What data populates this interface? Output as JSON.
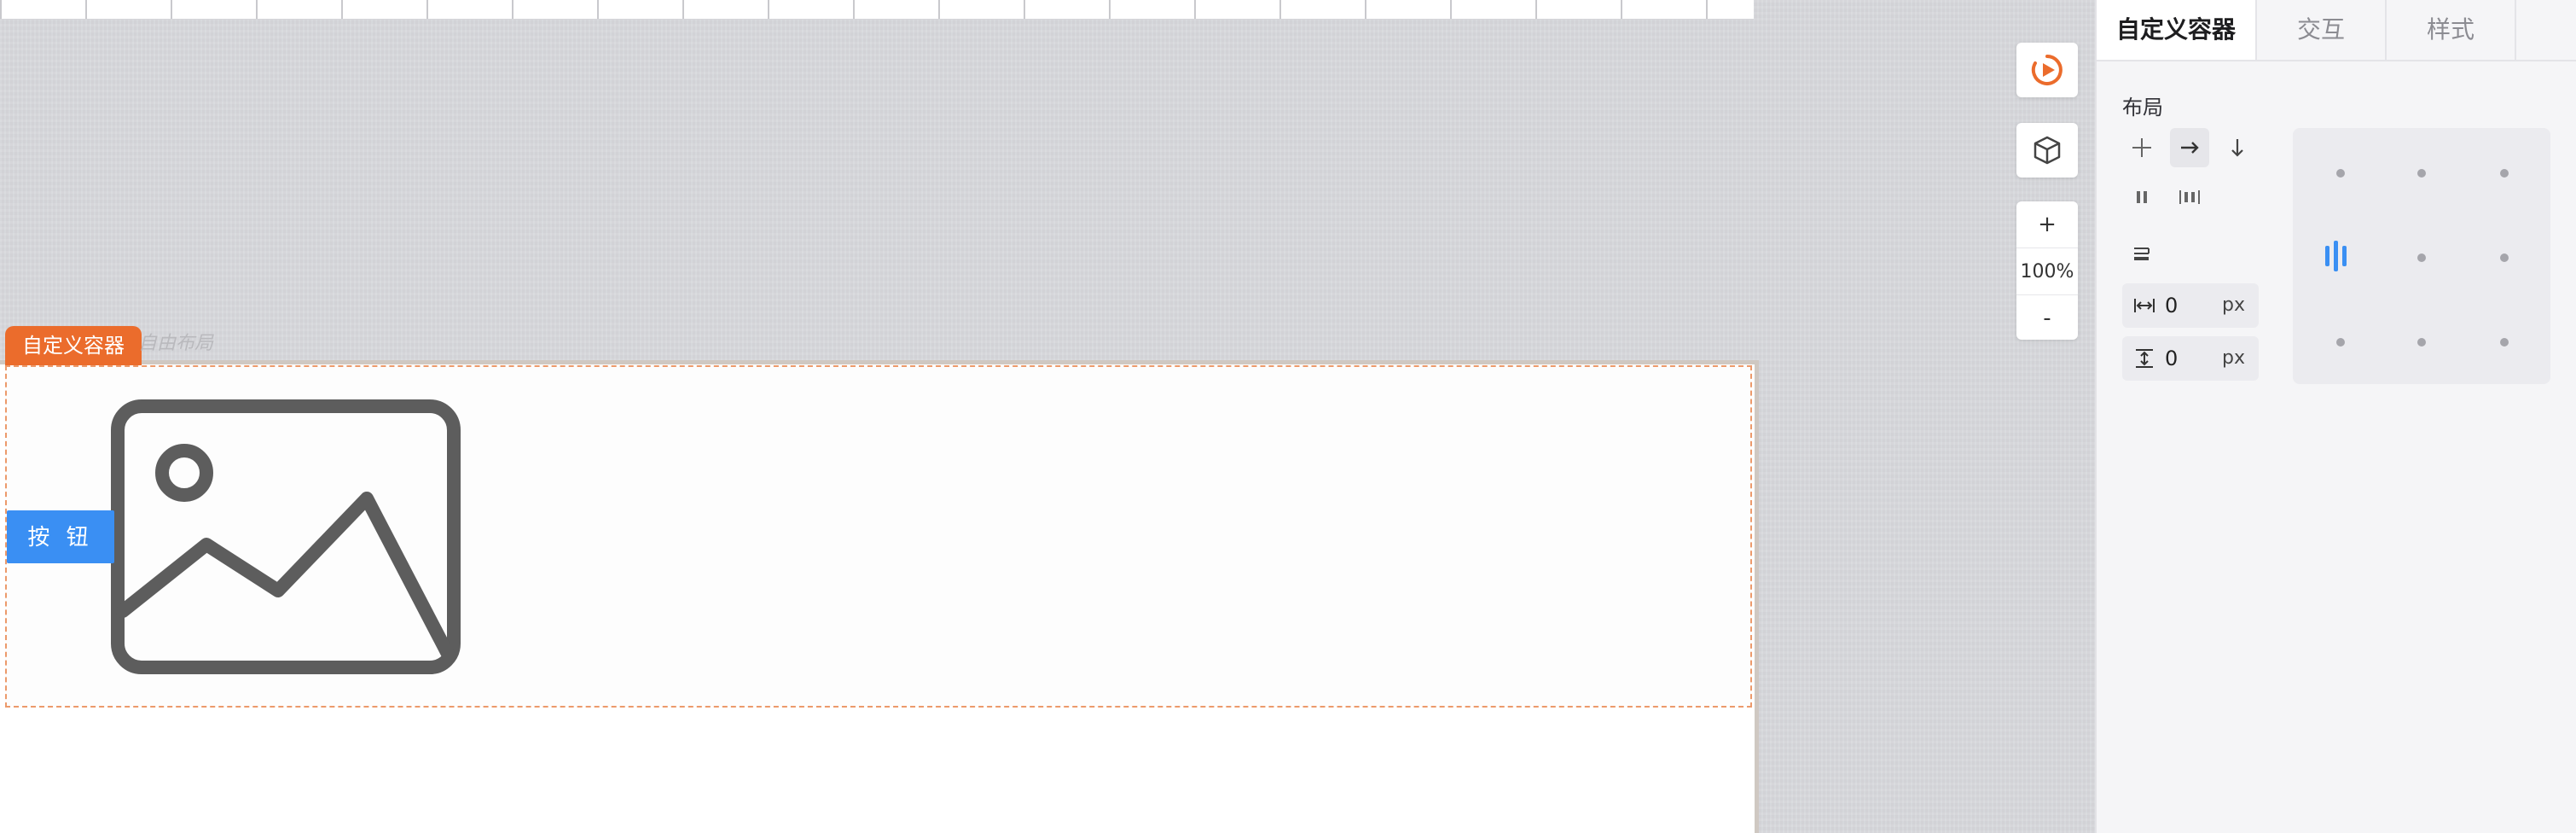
{
  "canvas": {
    "container_tag": "自定义容器",
    "ghost_label": "自由布局",
    "button_label": "按 钮",
    "zoom_in": "+",
    "zoom_level": "100%",
    "zoom_out": "-",
    "icons": [
      "preview-play-icon",
      "cube-icon",
      "image-icon"
    ]
  },
  "panel": {
    "tabs": [
      {
        "label": "自定义容器",
        "active": true
      },
      {
        "label": "交互",
        "active": false
      },
      {
        "label": "样式",
        "active": false
      }
    ],
    "layout_title": "布局",
    "gap_horizontal": {
      "value": "0",
      "unit": "px"
    },
    "gap_vertical": {
      "value": "0",
      "unit": "px"
    },
    "icons": [
      "free-layout-icon",
      "direction-row-icon",
      "direction-column-icon",
      "justify-space-around-icon",
      "justify-space-between-icon",
      "wrap-icon",
      "align-center-left-icon"
    ]
  },
  "colors": {
    "accent_orange": "#eb6c2c",
    "button_blue": "#3a8ff3",
    "canvas_bg": "#d7d8dc"
  }
}
